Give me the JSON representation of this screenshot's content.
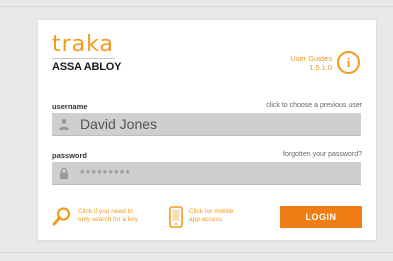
{
  "logo": {
    "brand": "traka",
    "parent": "ASSA ABLOY"
  },
  "guides": {
    "label": "User Guides",
    "version": "1.5.1.0"
  },
  "username": {
    "label": "username",
    "link": "click to choose a previous user",
    "value": "David Jones"
  },
  "password": {
    "label": "password",
    "link": "forgotten your password?",
    "value": "*********"
  },
  "search_key": {
    "line1": "Click if you need to",
    "line2": "only search for a key"
  },
  "mobile": {
    "line1": "Click for mobile",
    "line2": "app access"
  },
  "login": {
    "label": "LOGIN"
  },
  "colors": {
    "accent": "#f39a1c",
    "button": "#f07e14",
    "field": "#cfcfcf"
  }
}
